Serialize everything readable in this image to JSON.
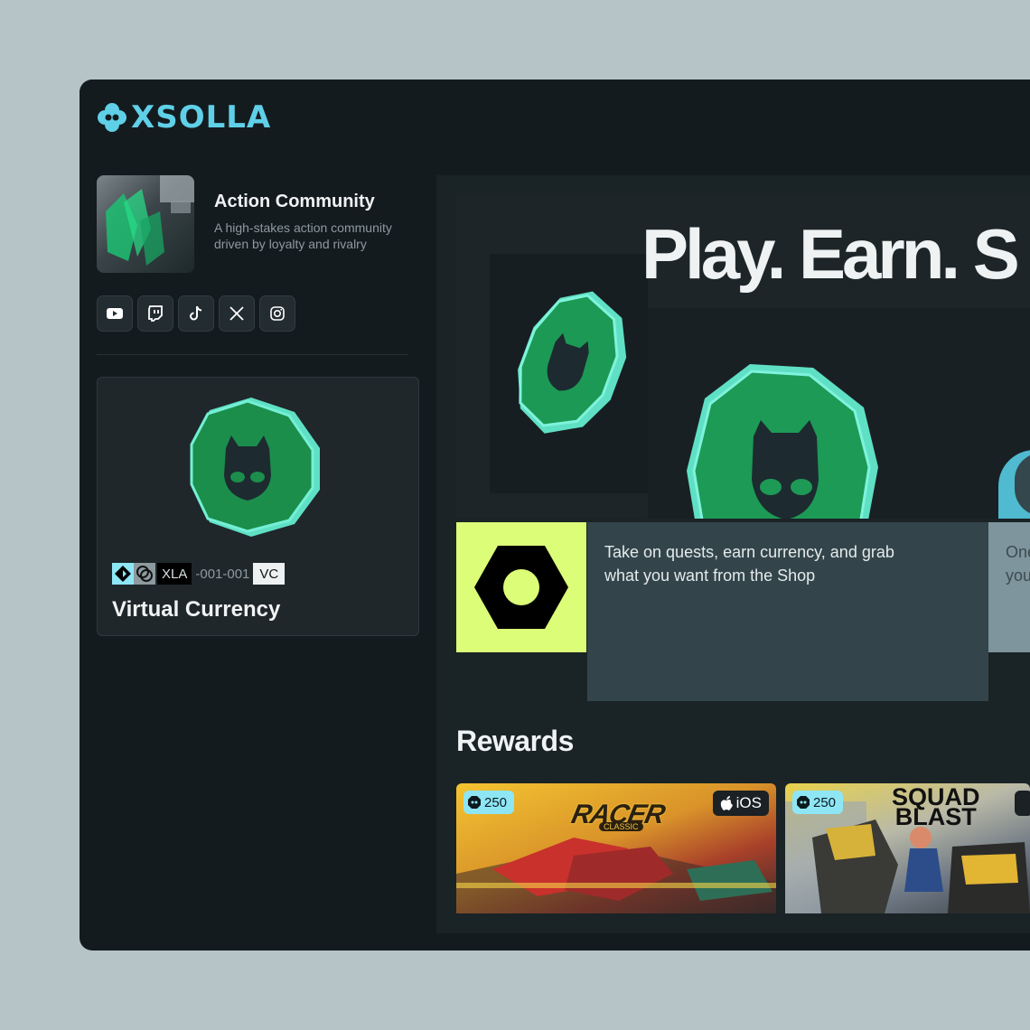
{
  "brand": {
    "logo_text": "XSOLLA"
  },
  "community": {
    "title": "Action Community",
    "description": "A high-stakes action community driven by loyalty and rivalry"
  },
  "socials": [
    {
      "name": "youtube-icon"
    },
    {
      "name": "twitch-icon"
    },
    {
      "name": "tiktok-icon"
    },
    {
      "name": "x-icon"
    },
    {
      "name": "instagram-icon"
    }
  ],
  "virtual_currency": {
    "sku_prefix": "XLA",
    "sku_number": "-001-001",
    "sku_type": "VC",
    "title": "Virtual Currency"
  },
  "hero": {
    "headline": "Play. Earn. S"
  },
  "info": {
    "quest_text": "Take on quests, earn currency, and grab what you want from the Shop",
    "side_text_line1": "One",
    "side_text_line2": "you"
  },
  "rewards": {
    "title": "Rewards",
    "items": [
      {
        "price": "250",
        "platform": "iOS",
        "game_logo": "RACER",
        "game_sub": "CLASSIC"
      },
      {
        "price": "250",
        "platform": "",
        "game_logo_line1": "SQUAD",
        "game_logo_line2": "BLAST"
      }
    ]
  },
  "colors": {
    "background": "#b6c3c7",
    "window": "#141b1e",
    "accent_cyan": "#5fd0e8",
    "accent_lime": "#dcfd78",
    "coin_green": "#1d8f4a"
  }
}
